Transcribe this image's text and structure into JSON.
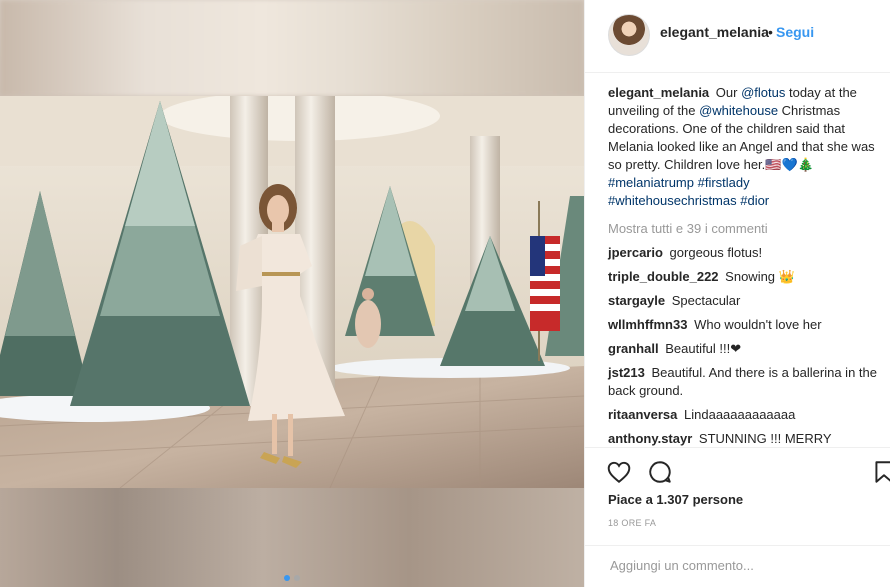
{
  "post": {
    "username": "elegant_melania",
    "follow_sep": "•",
    "follow_label": "Segui",
    "caption": {
      "username": "elegant_melania",
      "text1": "Our ",
      "mention1": "@flotus",
      "text2": " today at the unveiling of the ",
      "mention2": "@whitehouse",
      "text3": " Christmas decorations. One of the children said that Melania looked like an Angel and that she was so pretty. Children love her.🇺🇸💙🎄",
      "hashtags": "#melaniatrump #firstlady #whitehousechristmas #dior"
    },
    "view_all": "Mostra tutti e 39 i commenti",
    "comments": [
      {
        "user": "jpercario",
        "text": "gorgeous flotus!"
      },
      {
        "user": "triple_double_222",
        "text": "Snowing 👑"
      },
      {
        "user": "stargayle",
        "text": "Spectacular"
      },
      {
        "user": "wllmhffmn33",
        "text": "Who wouldn't love her"
      },
      {
        "user": "granhall",
        "text": "Beautiful !!!❤"
      },
      {
        "user": "jst213",
        "text": "Beautiful. And there is a ballerina in the back ground."
      },
      {
        "user": "ritaanversa",
        "text": "Lindaaaaaaaaaaaa"
      },
      {
        "user": "anthony.stayr",
        "text": "STUNNING !!! MERRY"
      }
    ],
    "likes": "Piace a 1.307 persone",
    "time": "18 ORE FA",
    "add_comment_placeholder": "Aggiungi un commento..."
  },
  "icons": {
    "like": "heart-icon",
    "comment": "comment-bubble-icon",
    "save": "bookmark-icon"
  },
  "colors": {
    "link": "#003569",
    "follow": "#3897f0",
    "muted": "#999999"
  },
  "carousel": {
    "slides": 2,
    "active": 1
  }
}
